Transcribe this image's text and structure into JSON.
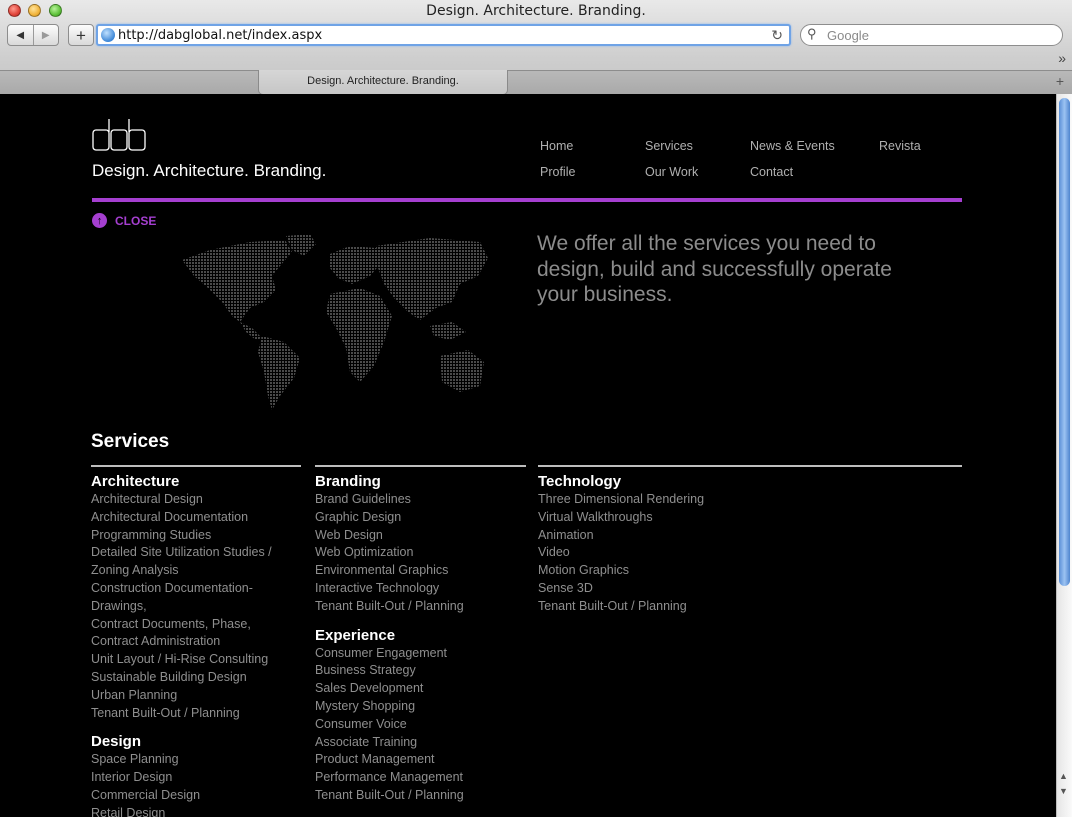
{
  "browser": {
    "window_title": "Design. Architecture. Branding.",
    "url": "http://dabglobal.net/index.aspx",
    "search_placeholder": "Google",
    "tab_title": "Design. Architecture. Branding.",
    "back_icon": "◀",
    "forward_icon": "▶",
    "add_icon": "+",
    "reload_icon": "↻",
    "search_icon": "⚲",
    "bookmarks_more": "»",
    "new_tab_icon": "+"
  },
  "site": {
    "logo_name": "dab-logo",
    "tagline": "Design. Architecture. Branding.",
    "accent_color": "#a53fd0",
    "nav": [
      {
        "label": "Home"
      },
      {
        "label": "Services"
      },
      {
        "label": "News & Events"
      },
      {
        "label": "Revista"
      },
      {
        "label": "Profile"
      },
      {
        "label": "Our Work"
      },
      {
        "label": "Contact"
      }
    ],
    "close_label": "CLOSE",
    "close_icon": "↑",
    "intro_text": "We offer all the services you need to design, build and successfully operate your business.",
    "services_title": "Services"
  },
  "columns": [
    {
      "groups": [
        {
          "title": "Architecture",
          "items": [
            "Architectural Design",
            "Architectural Documentation",
            "Programming Studies",
            "Detailed Site Utilization Studies /",
            "Zoning Analysis",
            "Construction Documentation-",
            "Drawings,",
            "Contract Documents, Phase,",
            "Contract Administration",
            "Unit Layout / Hi-Rise Consulting",
            "Sustainable Building Design",
            "Urban Planning",
            "Tenant Built-Out / Planning"
          ]
        },
        {
          "title": "Design",
          "items": [
            "Space Planning",
            "Interior Design",
            "Commercial Design",
            "Retail Design"
          ]
        }
      ]
    },
    {
      "groups": [
        {
          "title": "Branding",
          "items": [
            "Brand Guidelines",
            "Graphic Design",
            "Web Design",
            "Web Optimization",
            "Environmental Graphics",
            "Interactive Technology",
            "Tenant Built-Out / Planning"
          ]
        },
        {
          "title": "Experience",
          "items": [
            "Consumer Engagement",
            "Business Strategy",
            "Sales Development",
            "Mystery Shopping",
            "Consumer Voice",
            "Associate Training",
            "Product Management",
            "Performance Management",
            "Tenant Built-Out / Planning"
          ]
        }
      ]
    },
    {
      "groups": [
        {
          "title": "Technology",
          "items": [
            "Three Dimensional Rendering",
            "Virtual Walkthroughs",
            "Animation",
            "Video",
            "Motion Graphics",
            "Sense 3D",
            "Tenant Built-Out / Planning"
          ]
        }
      ]
    }
  ]
}
